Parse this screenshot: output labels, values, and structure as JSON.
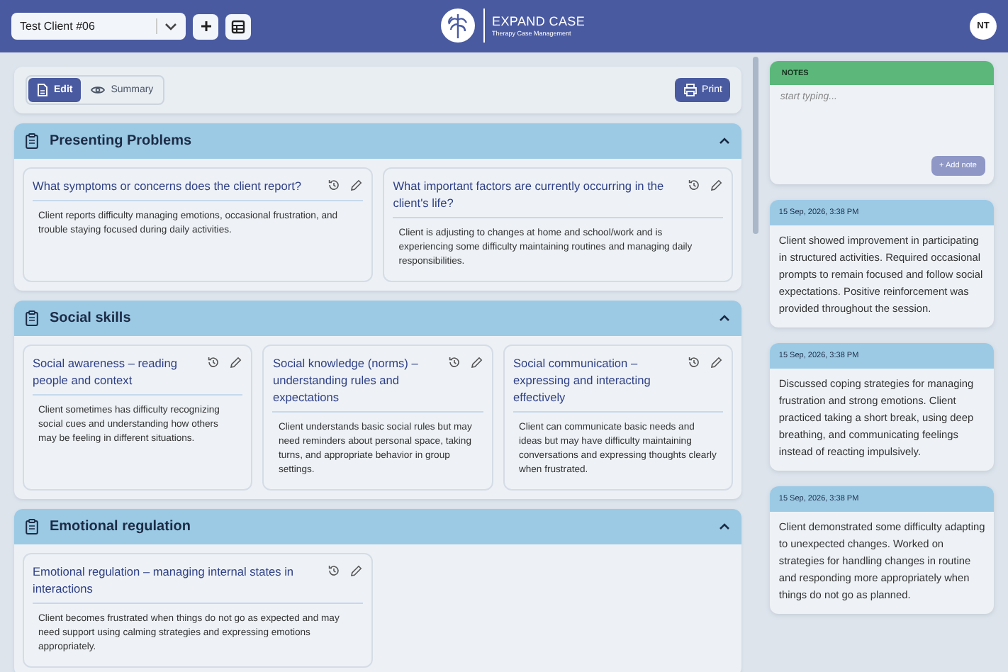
{
  "header": {
    "client_select": {
      "value": "Test Client #06"
    },
    "logo": {
      "name": "**EXPAND** CASE",
      "tagline": "Therapy Case Management"
    },
    "avatar": "NT"
  },
  "toolbar": {
    "tabs": [
      {
        "label": "Edit",
        "selected": true
      },
      {
        "label": "Summary",
        "selected": false
      }
    ],
    "print_button": "Print"
  },
  "sections": [
    {
      "title": "Presenting Problems",
      "expanded": true,
      "cards": [
        {
          "question": "What symptoms or concerns does the client report?",
          "answer": "Client reports difficulty managing emotions, occasional frustration, and trouble staying focused during daily activities."
        },
        {
          "question": "What important factors are currently occurring in the client's life?",
          "answer": "Client is adjusting to changes at home and school/work and is experiencing some difficulty maintaining routines and managing daily responsibilities."
        }
      ]
    },
    {
      "title": "Social skills",
      "expanded": true,
      "cards": [
        {
          "question": "Social awareness – reading people and context",
          "answer": "Client sometimes has difficulty recognizing social cues and understanding how others may be feeling in different situations."
        },
        {
          "question": "Social knowledge (norms) – understanding rules and expectations",
          "answer": "Client understands basic social rules but may need reminders about personal space, taking turns, and appropriate behavior in group settings."
        },
        {
          "question": "Social communication – expressing and interacting effectively",
          "answer": "Client can communicate basic needs and ideas but may have difficulty maintaining conversations and expressing thoughts clearly when frustrated."
        }
      ]
    },
    {
      "title": "Emotional regulation",
      "expanded": true,
      "cards": [
        {
          "question": "Emotional regulation – managing internal states in interactions",
          "answer": "Client becomes frustrated when things do not go as expected and may need support using calming strategies and expressing emotions appropriately."
        }
      ]
    }
  ],
  "notes": {
    "title": "NOTES",
    "placeholder": "start typing...",
    "add_button": "+ Add note",
    "add_disabled": true,
    "entries": [
      {
        "timestamp": "15 Sep, 2026, 3:38 PM",
        "text": "Client showed improvement in participating in structured activities. Required occasional prompts to remain focused and follow social expectations. Positive reinforcement was provided throughout the session."
      },
      {
        "timestamp": "15 Sep, 2026, 3:38 PM",
        "text": "Discussed coping strategies for managing frustration and strong emotions. Client practiced taking a short break, using deep breathing, and communicating feelings instead of reacting impulsively."
      },
      {
        "timestamp": "15 Sep, 2026, 3:38 PM",
        "text": "Client demonstrated some difficulty adapting to unexpected changes. Worked on strategies for handling changes in routine and responding more appropriately when things do not go as planned."
      }
    ]
  }
}
